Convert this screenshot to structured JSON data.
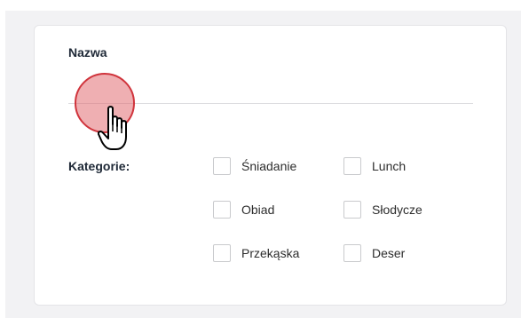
{
  "form": {
    "name_label": "Nazwa",
    "name_value": "",
    "categories_label": "Kategorie:",
    "categories": [
      {
        "label": "Śniadanie",
        "checked": false
      },
      {
        "label": "Lunch",
        "checked": false
      },
      {
        "label": "Obiad",
        "checked": false
      },
      {
        "label": "Słodycze",
        "checked": false
      },
      {
        "label": "Przekąska",
        "checked": false
      },
      {
        "label": "Deser",
        "checked": false
      }
    ]
  },
  "overlay": {
    "marker_color": "#d0343c",
    "cursor_icon": "hand-pointer-icon"
  }
}
